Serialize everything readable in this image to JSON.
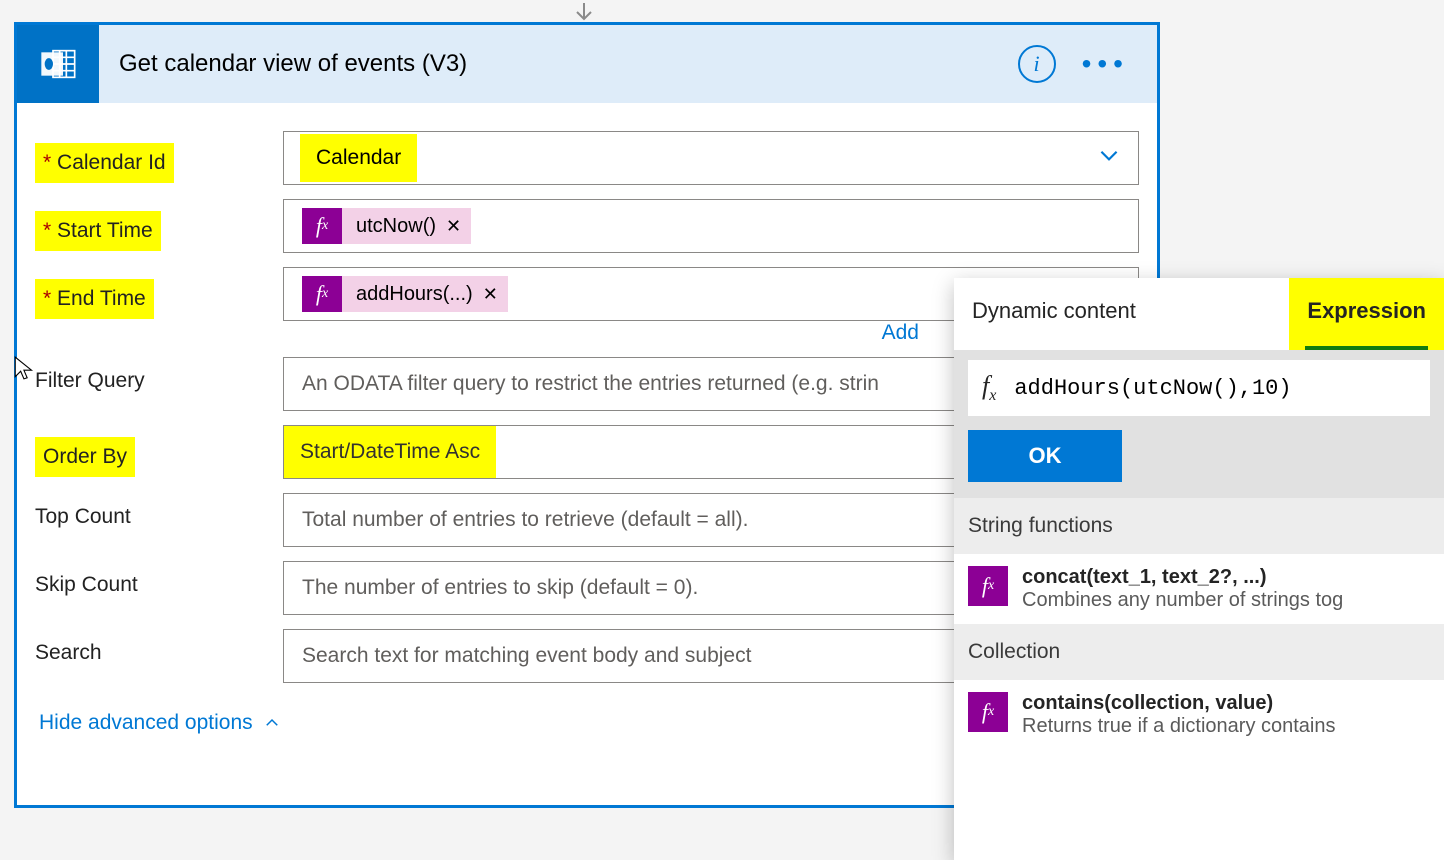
{
  "header": {
    "title": "Get calendar view of events (V3)"
  },
  "fields": {
    "calendar_id": {
      "label": "Calendar Id",
      "value": "Calendar"
    },
    "start_time": {
      "label": "Start Time",
      "token": "utcNow()"
    },
    "end_time": {
      "label": "End Time",
      "token": "addHours(...)",
      "add_link": "Add"
    },
    "filter_query": {
      "label": "Filter Query",
      "placeholder": "An ODATA filter query to restrict the entries returned (e.g. strin"
    },
    "order_by": {
      "label": "Order By",
      "value": "Start/DateTime Asc"
    },
    "top_count": {
      "label": "Top Count",
      "placeholder": "Total number of entries to retrieve (default = all)."
    },
    "skip_count": {
      "label": "Skip Count",
      "placeholder": "The number of entries to skip (default = 0)."
    },
    "search": {
      "label": "Search",
      "placeholder": "Search text for matching event body and subject"
    }
  },
  "advanced_toggle": "Hide advanced options",
  "popover": {
    "tabs": {
      "dynamic": "Dynamic content",
      "expression": "Expression"
    },
    "expression_value": "addHours(utcNow(),10)",
    "ok_label": "OK",
    "sections": {
      "string": {
        "title": "String functions",
        "fn_sig": "concat(text_1, text_2?, ...)",
        "fn_desc": "Combines any number of strings tog"
      },
      "collection": {
        "title": "Collection",
        "fn_sig": "contains(collection, value)",
        "fn_desc": "Returns true if a dictionary contains"
      }
    }
  }
}
